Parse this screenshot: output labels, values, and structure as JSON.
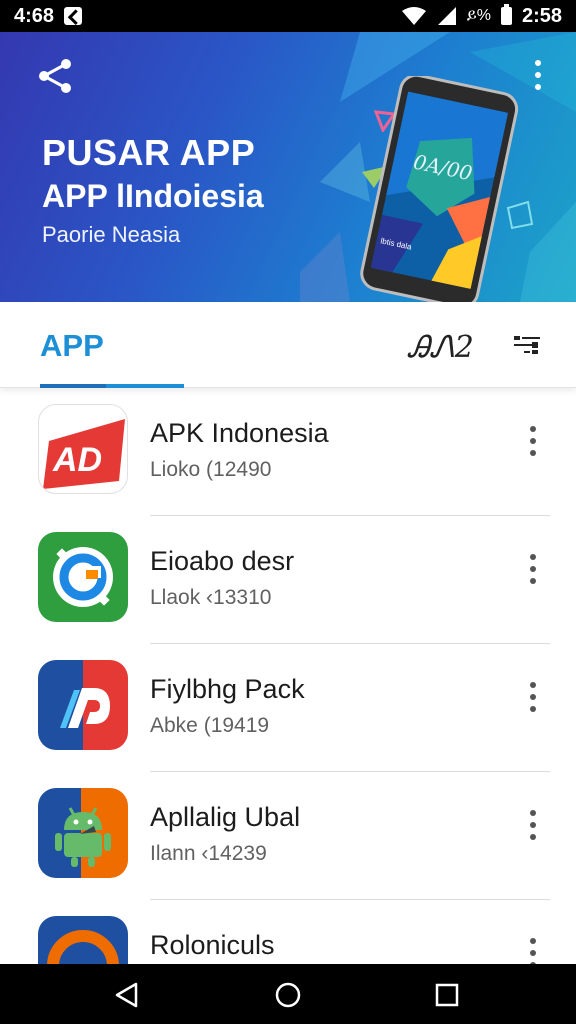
{
  "status_bar": {
    "time_left": "4:68",
    "battery_text": "ይ%",
    "time_right": "2:58"
  },
  "hero": {
    "title": "PUSAR APP",
    "subtitle": "APP lIndoiesia",
    "tagline": "Paorie Neasia",
    "phone_screen_text": "0A/00",
    "phone_bottom_text": "lbtis dala"
  },
  "tabs": {
    "active_label": "APP",
    "count_label": "ᎯᏁ2"
  },
  "apps": [
    {
      "title": "APK Indonesia",
      "meta": "Lioko (12490"
    },
    {
      "title": "Eioabo desr",
      "meta": "Llaok ‹13310"
    },
    {
      "title": "Fiylbhg Pack",
      "meta": "Abke (19419"
    },
    {
      "title": "Apllalig Ubal",
      "meta": "Ilann ‹14239"
    },
    {
      "title": "Roloniculs",
      "meta": ""
    }
  ],
  "colors": {
    "accent": "#1d8fd6",
    "hero_start": "#3438b0",
    "hero_end": "#1ba4c8"
  },
  "icons": {
    "share": "share-icon",
    "more": "more-vert-icon",
    "filter": "filter-icon",
    "back": "nav-back-icon",
    "home": "nav-home-icon",
    "recents": "nav-recents-icon"
  }
}
